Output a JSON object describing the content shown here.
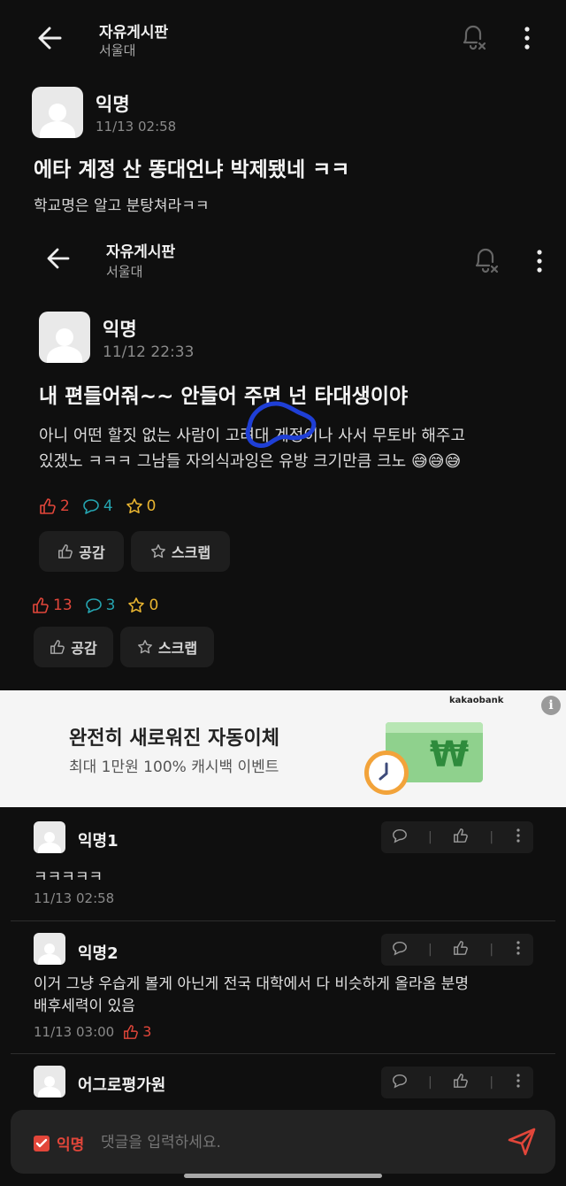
{
  "outer_header": {
    "title": "자유게시판",
    "subtitle": "서울대"
  },
  "outer_post": {
    "author": "익명",
    "date": "11/13 02:58",
    "title": "에타 계정 산 똥대언냐 박제됐네 ㅋㅋ",
    "body": "학교명은 알고 분탕쳐라ㅋㅋ",
    "likes": "13",
    "comments": "3",
    "scraps": "0",
    "like_label": "공감",
    "scrap_label": "스크랩"
  },
  "inner_header": {
    "title": "자유게시판",
    "subtitle": "서울대"
  },
  "inner_post": {
    "author": "익명",
    "date": "11/12 22:33",
    "title": "내 편들어줘~~ 안들어 주면 넌 타대생이야",
    "body_line1": "아니 어떤 할짓 없는 사람이 고려대 계정이나 사서 무토바 해주고",
    "body_line2": "있겠노 ㅋㅋㅋ 그남들 자의식과잉은 유방 크기만큼 크노",
    "emoji": "😅😅😅",
    "likes": "2",
    "comments": "4",
    "scraps": "0",
    "like_label": "공감",
    "scrap_label": "스크랩"
  },
  "ad": {
    "brand": "kakaobank",
    "headline": "완전히 새로워진 자동이체",
    "sub": "최대 1만원 100% 캐시백 이벤트",
    "currency_symbol": "₩",
    "info_symbol": "i"
  },
  "comments": [
    {
      "author": "익명1",
      "text": "ㅋㅋㅋㅋㅋ",
      "date": "11/13 02:58",
      "likes": ""
    },
    {
      "author": "익명2",
      "text_line1": "이거 그냥 우습게 볼게 아닌게 전국 대학에서 다 비슷하게 올라옴 분명",
      "text_line2": "배후세력이 있음",
      "date": "11/13 03:00",
      "likes": "3"
    },
    {
      "author": "어그로평가원"
    }
  ],
  "composer": {
    "anon_label": "익명",
    "placeholder": "댓글을 입력하세요."
  },
  "colors": {
    "like": "#e2463a",
    "comment": "#25a4b0",
    "scrap": "#e8b430",
    "ad_bg": "#f5f5f5",
    "accent": "#e2463a"
  }
}
